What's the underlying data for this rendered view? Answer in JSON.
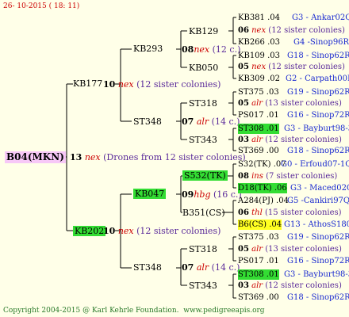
{
  "header": {
    "date": "26- 10-2015 ( 18: 11)"
  },
  "footer": {
    "copyright": "Copyright 2004-2015 @ Karl Kehrle Foundation.",
    "url": "www.pedigreeapis.org"
  },
  "root": {
    "name": "B04(MKN)",
    "num": "13",
    "nex": "nex",
    "desc": "(Drones from 12 sister colonies)"
  },
  "gen1": [
    {
      "name": "KB177",
      "num": "10",
      "race": "nex",
      "desc": "(12 sister colonies)"
    },
    {
      "name": "KB202",
      "num": "10",
      "race": "nex",
      "desc": "(12 sister colonies)"
    }
  ],
  "gen2": [
    {
      "name": "KB293",
      "num": "08",
      "race": "nex",
      "desc": "(12 c.)"
    },
    {
      "name": "ST348",
      "num": "07",
      "race": "alr",
      "desc": "(14 c.)"
    },
    {
      "name": "KB047",
      "num": "09",
      "race": "hbg",
      "desc": "(16 c.)"
    },
    {
      "name": "ST348",
      "num": "07",
      "race": "alr",
      "desc": "(14 c.)"
    }
  ],
  "gen3": [
    {
      "name": "KB129"
    },
    {
      "name": "KB050"
    },
    {
      "name": "ST318"
    },
    {
      "name": "ST343"
    },
    {
      "name": "S532(TK)"
    },
    {
      "name": "B351(CS)"
    },
    {
      "name": "ST318"
    },
    {
      "name": "ST343"
    }
  ],
  "leaves": [
    {
      "id": "KB381 .04",
      "loc": "G3 - Ankar02Q"
    },
    {
      "num": "06",
      "race": "nex",
      "desc": "(12 sister colonies)"
    },
    {
      "id": "KB266 .03",
      "loc": "G4 -Sinop96R"
    },
    {
      "id": "KB109 .03",
      "loc": "G18 - Sinop62R"
    },
    {
      "num": "05",
      "race": "nex",
      "desc": "(12 sister colonies)"
    },
    {
      "id": "KB309 .02",
      "loc": "G2 - Carpath00R"
    },
    {
      "id": "ST375 .03",
      "loc": "G19 - Sinop62R"
    },
    {
      "num": "05",
      "race": "alr",
      "desc": "(13 sister colonies)"
    },
    {
      "id": "PS017 .01",
      "loc": "G16 - Sinop72R"
    },
    {
      "id": "ST308 .01",
      "loc": "G3 - Bayburt98-3"
    },
    {
      "num": "03",
      "race": "alr",
      "desc": "(12 sister colonies)"
    },
    {
      "id": "ST369 .00",
      "loc": "G18 - Sinop62R"
    },
    {
      "id": "S32(TK) .07",
      "loc": "G0 - Erfoud07-1Q"
    },
    {
      "num": "08",
      "race": "ins",
      "desc": "(7 sister colonies)"
    },
    {
      "id": "D18(TK) .06",
      "loc": "G3 - Maced02Q"
    },
    {
      "id": "A284(PJ) .04",
      "loc": "G5 -Cankiri97Q"
    },
    {
      "num": "06",
      "race": "thl",
      "desc": "(15 sister colonies)"
    },
    {
      "id": "B6(CS) .04",
      "loc": "G13 - AthosS180R"
    },
    {
      "id": "ST375 .03",
      "loc": "G19 - Sinop62R"
    },
    {
      "num": "05",
      "race": "alr",
      "desc": "(13 sister colonies)"
    },
    {
      "id": "PS017 .01",
      "loc": "G16 - Sinop72R"
    },
    {
      "id": "ST308 .01",
      "loc": "G3 - Bayburt98-3"
    },
    {
      "num": "03",
      "race": "alr",
      "desc": "(12 sister colonies)"
    },
    {
      "id": "ST369 .00",
      "loc": "G18 - Sinop62R"
    }
  ]
}
